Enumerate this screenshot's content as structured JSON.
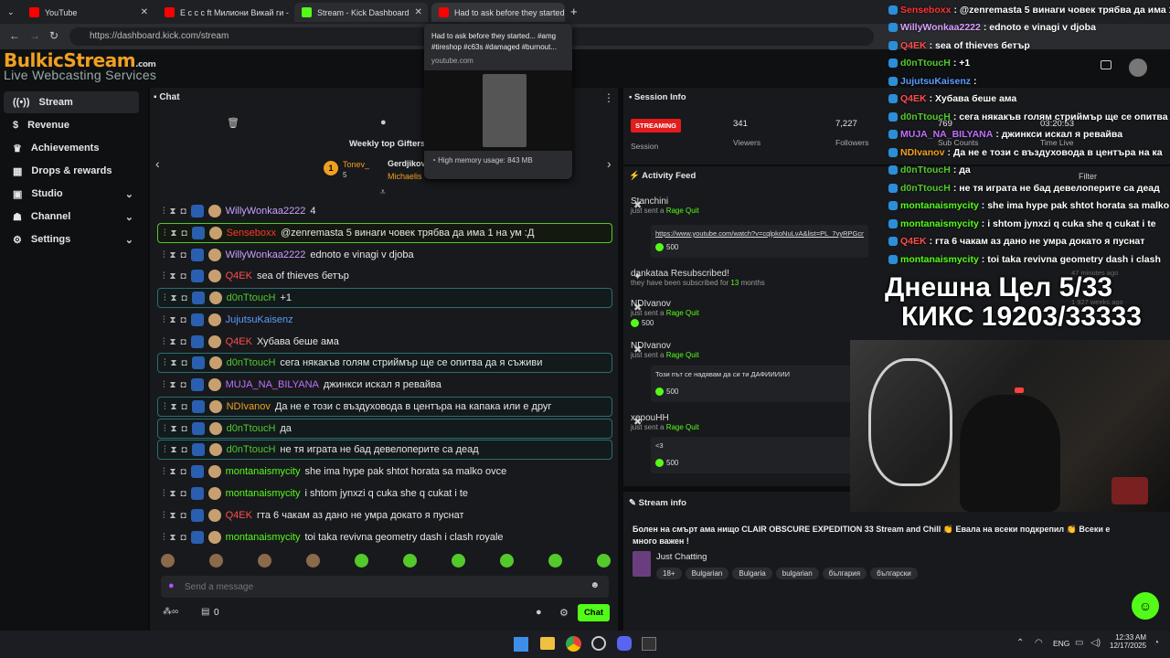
{
  "browser": {
    "tabs": [
      {
        "label": "YouTube",
        "color": "#ff0000"
      },
      {
        "label": "E c c c ft Милиони Викай ги - Y",
        "color": "#ff0000"
      },
      {
        "label": "Stream - Kick Dashboard",
        "color": "#53fc18"
      },
      {
        "label": "Had to ask before they started",
        "color": "#ff0000"
      }
    ],
    "url": "https://dashboard.kick.com/stream",
    "hover_card": {
      "title": "Had to ask before they started... #amg #tireshop #c63s #damaged #burnout...",
      "domain": "youtube.com",
      "memory": "High memory usage: 843 MB"
    }
  },
  "logo": {
    "main": "BulkicStream",
    "sub": ".com",
    "tagline": "Live Webcasting Services"
  },
  "sidebar": {
    "items": [
      {
        "label": "Stream",
        "icon": "radio-icon"
      },
      {
        "label": "Revenue",
        "icon": "dollar-icon"
      },
      {
        "label": "Achievements",
        "icon": "trophy-icon"
      },
      {
        "label": "Drops & rewards",
        "icon": "gift-icon"
      },
      {
        "label": "Studio",
        "icon": "grid-icon"
      },
      {
        "label": "Channel",
        "icon": "user-icon"
      },
      {
        "label": "Settings",
        "icon": "gear-icon"
      }
    ]
  },
  "chat": {
    "title": "Chat",
    "gifters_title": "Weekly top Gifters",
    "gifters": [
      {
        "name": "Tonev_",
        "count": "5"
      },
      {
        "name": "Gerdjikov"
      },
      {
        "name": "Michaelis"
      }
    ],
    "messages": [
      {
        "user": "WillyWonkaa2222",
        "color": "#c8a0ff",
        "text": "4"
      },
      {
        "user": "Senseboxx",
        "color": "#ff3333",
        "text": "@zenremasta 5 винаги човек трябва да има 1 на ум :Д"
      },
      {
        "user": "WillyWonkaa2222",
        "color": "#c8a0ff",
        "text": "ednoto e vinagi v djoba"
      },
      {
        "user": "Q4EK",
        "color": "#ff4d4d",
        "text": "sea of thieves бетър"
      },
      {
        "user": "d0nTtoucH",
        "color": "#53c92b",
        "text": "+1"
      },
      {
        "user": "JujutsuKaisenz",
        "color": "#5b9bff",
        "text": ""
      },
      {
        "user": "Q4EK",
        "color": "#ff4d4d",
        "text": "Хубава беше ама"
      },
      {
        "user": "d0nTtoucH",
        "color": "#53c92b",
        "text": "сега някакъв голям стриймър ще се опитва да я съживи"
      },
      {
        "user": "MUJA_NA_BILYANA",
        "color": "#c070ff",
        "text": "джинкси искал я ревайва"
      },
      {
        "user": "NDIvanov",
        "color": "#f0a020",
        "text": "Да не е този с въздуховода в центъра на капака или е друг"
      },
      {
        "user": "d0nTtoucH",
        "color": "#53c92b",
        "text": "да"
      },
      {
        "user": "d0nTtoucH",
        "color": "#53c92b",
        "text": "не тя играта не бад девелоперите са деад"
      },
      {
        "user": "montanaismycity",
        "color": "#53fc18",
        "text": "she ima hype pak shtot horata sa malko ovce"
      },
      {
        "user": "montanaismycity",
        "color": "#53fc18",
        "text": "i shtom jynxzi q cuka she q cukat i te"
      },
      {
        "user": "Q4EK",
        "color": "#ff4d4d",
        "text": "гта 6 чакам аз дано не умра докато я пуснат"
      },
      {
        "user": "montanaismycity",
        "color": "#53fc18",
        "text": "toi taka revivna geometry dash i clash royale"
      }
    ],
    "placeholder": "Send a message",
    "footer_count": "0",
    "send_label": "Chat"
  },
  "session": {
    "title": "Session Info",
    "badge": "STREAMING",
    "badge_label": "Session",
    "viewers": "341",
    "viewers_label": "Viewers",
    "followers": "7,227",
    "followers_label": "Followers",
    "subs": "769",
    "subs_label": "Sub Counts",
    "live": "03:20:53",
    "live_label": "Time Live"
  },
  "activity": {
    "title": "Activity Feed",
    "filter": "Filter",
    "items": [
      {
        "name": "Stanchini",
        "sub": "just sent a",
        "reward": "Rage Quit",
        "link": "https://www.youtube.com/watch?v=cqlpkoNuLvA&list=PL_7vyRPGcnYwjuCbaxGVTFsYF8JbhHbcc&index=60",
        "coins": "500"
      },
      {
        "name": "dankataa Resubscribed!",
        "sub": "they have been subscribed for",
        "months": "13",
        "months_label": "months"
      },
      {
        "name": "NDIvanov",
        "sub": "just sent a",
        "reward": "Rage Quit",
        "coins": "500"
      },
      {
        "name": "NDIvanov",
        "sub": "just sent a",
        "reward": "Rage Quit",
        "message": "Този път се надявам да си ти ДАФИИИИИ",
        "coins": "500"
      },
      {
        "name": "xepouHH",
        "sub": "just sent a",
        "reward": "Rage Quit",
        "message": "<3",
        "coins": "500"
      }
    ],
    "time1": "47 minutes ago",
    "time2": "1 927 weeks ago"
  },
  "stream_info": {
    "title": "Stream info",
    "stream_title": "Болен на смърт ама нищо CLAIR OBSCURE EXPEDITION 33 Stream and Chill 👏 Евала на всеки подкрепил 👏 Всеки е много важен !",
    "category": "Just Chatting",
    "tags": [
      "18+",
      "Bulgarian",
      "Bulgaria",
      "bulgarian",
      "българия",
      "български"
    ]
  },
  "overlay": {
    "goal1": "Днешна Цел 5/33",
    "goal2": "КИКС 19203/33333",
    "chat": [
      {
        "user": "Senseboxx",
        "color": "#ff3333",
        "text": ": @zenremasta 5 винаги човек трябва да има 1 на у"
      },
      {
        "user": "WillyWonkaa2222",
        "color": "#d7a0ff",
        "text": ": ednoto e vinagi v djoba"
      },
      {
        "user": "Q4EK",
        "color": "#ff4d4d",
        "text": ": sea of thieves бетър"
      },
      {
        "user": "d0nTtoucH",
        "color": "#53c92b",
        "text": ": +1"
      },
      {
        "user": "JujutsuKaisenz",
        "color": "#5b9bff",
        "text": ":"
      },
      {
        "user": "Q4EK",
        "color": "#ff4d4d",
        "text": ": Хубава беше ама"
      },
      {
        "user": "d0nTtoucH",
        "color": "#53c92b",
        "text": ": сега някакъв голям стриймър ще се опитва"
      },
      {
        "user": "MUJA_NA_BILYANA",
        "color": "#c070ff",
        "text": ": джинкси искал я ревайва"
      },
      {
        "user": "NDIvanov",
        "color": "#f0a020",
        "text": ": Да не е този с въздуховода в центъра на ка"
      },
      {
        "user": "d0nTtoucH",
        "color": "#53c92b",
        "text": ": да"
      },
      {
        "user": "d0nTtoucH",
        "color": "#53c92b",
        "text": ": не тя играта не бад девелоперите са деад"
      },
      {
        "user": "montanaismycity",
        "color": "#53fc18",
        "text": ": she ima hype pak shtot horata sa malko"
      },
      {
        "user": "montanaismycity",
        "color": "#53fc18",
        "text": ": i shtom jynxzi q cuka she q cukat i te"
      },
      {
        "user": "Q4EK",
        "color": "#ff4d4d",
        "text": ": гта 6 чакам аз дано не умра докато я пуснат"
      },
      {
        "user": "montanaismycity",
        "color": "#53fc18",
        "text": ": toi taka revivna geometry dash i clash"
      }
    ]
  },
  "taskbar": {
    "lang": "ENG",
    "time": "12:33 AM",
    "date": "12/17/2025"
  }
}
